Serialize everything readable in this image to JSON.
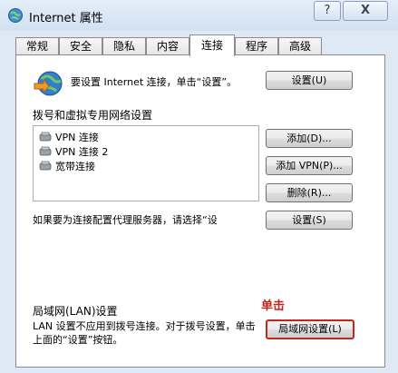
{
  "window": {
    "title": "Internet 属性",
    "help_glyph": "?",
    "close_glyph": "X"
  },
  "tabs": [
    {
      "label": "常规"
    },
    {
      "label": "安全"
    },
    {
      "label": "隐私"
    },
    {
      "label": "内容"
    },
    {
      "label": "连接",
      "active": true
    },
    {
      "label": "程序"
    },
    {
      "label": "高级"
    }
  ],
  "setup": {
    "text": "要设置 Internet 连接，单击“设置”。",
    "button": "设置(U)"
  },
  "dialup": {
    "heading": "拨号和虚拟专用网络设置",
    "connections": [
      "VPN 连接",
      "VPN 连接 2",
      "宽带连接"
    ],
    "add_button": "添加(D)...",
    "add_vpn_button": "添加 VPN(P)...",
    "remove_button": "删除(R)...",
    "proxy_text": "如果要为连接配置代理服务器，请选择“设",
    "settings_button": "设置(S)"
  },
  "lan": {
    "heading": "局域网(LAN)设置",
    "description": "LAN 设置不应用到拨号连接。对于拨号设置，单击上面的“设置”按钮。",
    "button": "局域网设置(L)"
  },
  "annotation": "单击",
  "colors": {
    "accent_red": "#c0271e",
    "window_bg": "#dfe9f5"
  },
  "icons": {
    "app": "internet-options-icon",
    "globe": "network-globe-icon",
    "connection": "network-connection-icon"
  }
}
